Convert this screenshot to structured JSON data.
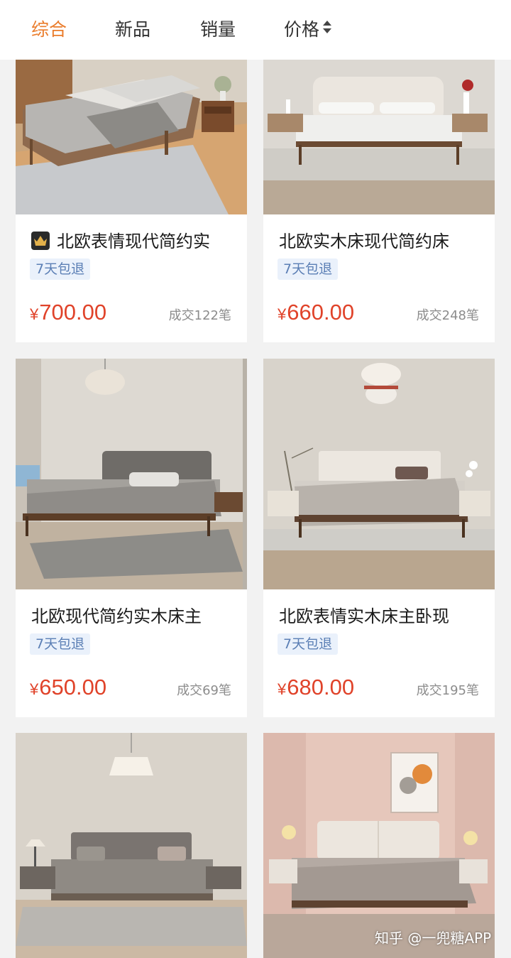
{
  "sort_tabs": [
    {
      "label": "综合",
      "active": true
    },
    {
      "label": "新品",
      "active": false
    },
    {
      "label": "销量",
      "active": false
    },
    {
      "label": "价格",
      "active": false,
      "icon": "sort-updown-icon"
    }
  ],
  "products": [
    {
      "title": "北欧表情现代简约实",
      "badge": "7天包退",
      "currency": "¥",
      "price": "700.00",
      "sold": "成交122笔",
      "shop_icon": "crown-icon"
    },
    {
      "title": "北欧实木床现代简约床",
      "badge": "7天包退",
      "currency": "¥",
      "price": "660.00",
      "sold": "成交248笔"
    },
    {
      "title": "北欧现代简约实木床主",
      "badge": "7天包退",
      "currency": "¥",
      "price": "650.00",
      "sold": "成交69笔"
    },
    {
      "title": "北欧表情实木床主卧现",
      "badge": "7天包退",
      "currency": "¥",
      "price": "680.00",
      "sold": "成交195笔"
    },
    {
      "title": "",
      "badge": "",
      "currency": "",
      "price": "",
      "sold": ""
    },
    {
      "title": "",
      "badge": "",
      "currency": "",
      "price": "",
      "sold": ""
    }
  ],
  "watermark": "知乎 @一兜糖APP",
  "colors": {
    "accent": "#ea7c2b",
    "price": "#e0432a",
    "badge_bg": "#eaf1fb",
    "badge_text": "#5b7fb5"
  }
}
